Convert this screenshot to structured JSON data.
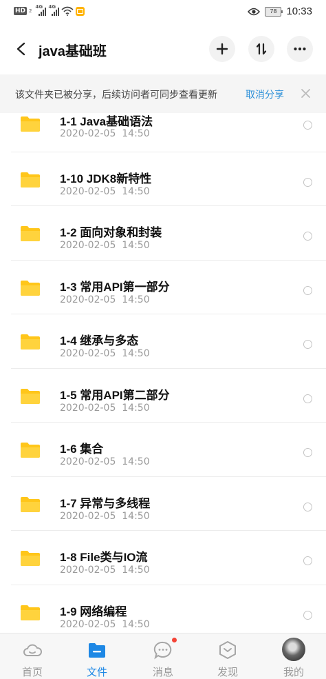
{
  "status_bar": {
    "hd_label": "HD",
    "hd_sub": "2",
    "net1": "4G",
    "net2": "4G",
    "battery": "78",
    "time": "10:33"
  },
  "header": {
    "title": "java基础班",
    "icons": [
      "back-icon",
      "plus-icon",
      "sort-icon",
      "more-icon"
    ]
  },
  "share_banner": {
    "message": "该文件夹已被分享，后续访问者可同步查看更新",
    "cancel_label": "取消分享"
  },
  "files": [
    {
      "name": "1-1 Java基础语法",
      "date": "2020-02-05  14:50"
    },
    {
      "name": "1-10 JDK8新特性",
      "date": "2020-02-05  14:50"
    },
    {
      "name": "1-2 面向对象和封装",
      "date": "2020-02-05  14:50"
    },
    {
      "name": "1-3 常用API第一部分",
      "date": "2020-02-05  14:50"
    },
    {
      "name": "1-4 继承与多态",
      "date": "2020-02-05  14:50"
    },
    {
      "name": "1-5 常用API第二部分",
      "date": "2020-02-05  14:50"
    },
    {
      "name": "1-6 集合",
      "date": "2020-02-05  14:50"
    },
    {
      "name": "1-7 异常与多线程",
      "date": "2020-02-05  14:50"
    },
    {
      "name": "1-8 File类与IO流",
      "date": "2020-02-05  14:50"
    },
    {
      "name": "1-9 网络编程",
      "date": "2020-02-05  14:50"
    }
  ],
  "nav": [
    {
      "label": "首页",
      "icon": "cloud-icon",
      "active": false
    },
    {
      "label": "文件",
      "icon": "folder-icon",
      "active": true
    },
    {
      "label": "消息",
      "icon": "chat-icon",
      "active": false
    },
    {
      "label": "发现",
      "icon": "compass-icon",
      "active": false
    },
    {
      "label": "我的",
      "icon": "avatar",
      "active": false
    }
  ],
  "colors": {
    "accent": "#1e88e5",
    "link": "#2a8fd8",
    "folder": "#ffc61a",
    "badge": "#f44336"
  }
}
